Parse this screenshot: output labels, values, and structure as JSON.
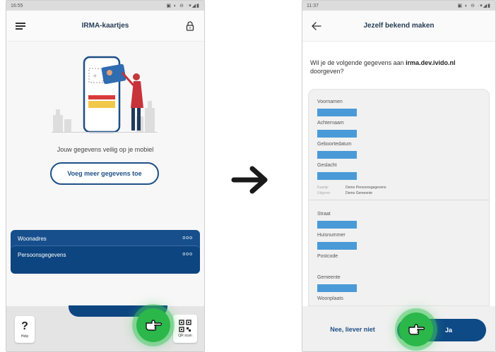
{
  "left_screen": {
    "status_time": "16:55",
    "status_icons": "▣ ◐ ⊖ ·▾◢▮",
    "title": "IRMA-kaartjes",
    "tagline": "Jouw gegevens veilig op je mobiel",
    "add_button": "Voeg meer gegevens toe",
    "cards": [
      {
        "label": "Woonadres",
        "menu": "ooo"
      },
      {
        "label": "Persoonsgegevens",
        "menu": "ooo"
      }
    ],
    "help_label": "Help",
    "help_glyph": "?",
    "qr_label": "QR scan",
    "icons": {
      "menu": "hamburger-menu-icon",
      "lock": "lock-icon",
      "qr": "qr-code-icon",
      "pointer": "pointing-hand-icon"
    }
  },
  "right_screen": {
    "status_time": "11:37",
    "status_icons": "▣ ◐ ⊖ ·▾◢▮",
    "title": "Jezelf bekend maken",
    "question_prefix": "Wil je de volgende gegevens aan ",
    "question_domain": "irma.dev.ivido.nl",
    "question_suffix": " doorgeven?",
    "group1": {
      "attributes": [
        "Voornamen",
        "Achternaam",
        "Geboortedatum",
        "Geslacht"
      ],
      "meta_card_key": "Kaartje",
      "meta_card_value": "Demo Persoonsgegevens",
      "meta_issuer_key": "Uitgever",
      "meta_issuer_value": "Demo Gemeente"
    },
    "group2": {
      "attributes": [
        "Straat",
        "Huisnummer",
        "Postcode",
        "Gemeente",
        "Woonplaats"
      ]
    },
    "no_button": "Nee, liever niet",
    "yes_button": "Ja",
    "icons": {
      "back": "back-arrow-icon",
      "pointer": "pointing-hand-icon"
    }
  },
  "colors": {
    "primary_blue": "#0e4a86",
    "redacted_value": "#4a9ad8",
    "highlight_green": "#2bb74a"
  }
}
